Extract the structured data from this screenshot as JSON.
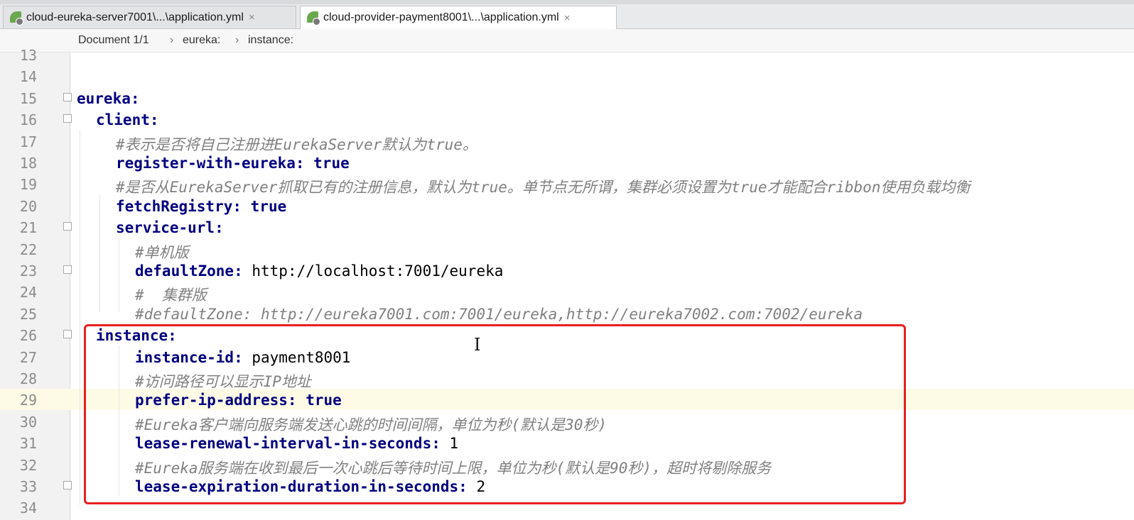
{
  "tabs": [
    {
      "label": "cloud-eureka-server7001\\...\\application.yml",
      "close": "×",
      "icon": "spring-leaf-icon",
      "active": false
    },
    {
      "label": "cloud-provider-payment8001\\...\\application.yml",
      "close": "×",
      "icon": "spring-leaf-icon",
      "active": true
    }
  ],
  "breadcrumb": {
    "document": "Document 1/1",
    "sep": "›",
    "items": [
      "eureka:",
      "instance:"
    ]
  },
  "lines": [
    {
      "num": "13"
    },
    {
      "num": "14"
    },
    {
      "num": "15",
      "key": "eureka:"
    },
    {
      "num": "16",
      "key": "client:"
    },
    {
      "num": "17",
      "comment": "#表示是否将自己注册进EurekaServer默认为true。"
    },
    {
      "num": "18",
      "key": "register-with-eureka:",
      "value": " true"
    },
    {
      "num": "19",
      "comment": "#是否从EurekaServer抓取已有的注册信息，默认为true。单节点无所谓，集群必须设置为true才能配合ribbon使用负载均衡"
    },
    {
      "num": "20",
      "key": "fetchRegistry:",
      "value": " true"
    },
    {
      "num": "21",
      "key": "service-url:"
    },
    {
      "num": "22",
      "comment": "#单机版"
    },
    {
      "num": "23",
      "key": "defaultZone:",
      "value": " http://localhost:7001/eureka"
    },
    {
      "num": "24",
      "comment": "#  集群版"
    },
    {
      "num": "25",
      "comment": "#defaultZone: http://eureka7001.com:7001/eureka,http://eureka7002.com:7002/eureka"
    },
    {
      "num": "26",
      "key": "instance:"
    },
    {
      "num": "27",
      "key": "instance-id:",
      "value": " payment8001"
    },
    {
      "num": "28",
      "comment": "#访问路径可以显示IP地址"
    },
    {
      "num": "29",
      "key": "prefer-ip-address:",
      "value": " true"
    },
    {
      "num": "30",
      "comment": "#Eureka客户端向服务端发送心跳的时间间隔，单位为秒(默认是30秒)"
    },
    {
      "num": "31",
      "key": "lease-renewal-interval-in-seconds:",
      "value": " 1"
    },
    {
      "num": "32",
      "comment": "#Eureka服务端在收到最后一次心跳后等待时间上限，单位为秒(默认是90秒)，超时将剔除服务"
    },
    {
      "num": "33",
      "key": "lease-expiration-duration-in-seconds:",
      "value": " 2"
    },
    {
      "num": "34"
    }
  ],
  "colors": {
    "highlight_box": "#e81f1f",
    "key": "#000080",
    "comment": "#808080",
    "current_line": "#fdfbe6"
  }
}
